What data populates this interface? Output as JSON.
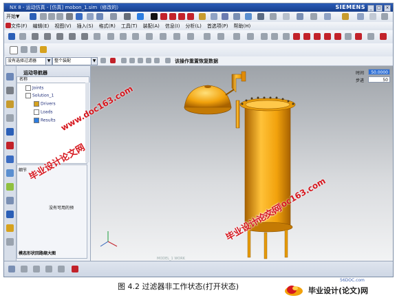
{
  "window": {
    "title": "NX 8 - 运动仿真 - [仿真] mobon_1.sim（修改的）",
    "brand": "SIEMENS",
    "controls": [
      "_",
      "□",
      "×"
    ]
  },
  "toolbar": {
    "start_label": "开始▼"
  },
  "menu": {
    "items": [
      "文件(F)",
      "编辑(E)",
      "视图(V)",
      "插入(S)",
      "格式(R)",
      "工具(T)",
      "装配(A)",
      "信息(I)",
      "分析(L)",
      "首选项(P)",
      "帮助(H)"
    ]
  },
  "selection_bar": {
    "filter": "没有选择过滤器",
    "scope": "整个装配",
    "hint": "该操作重置恢复数据"
  },
  "navigator": {
    "title": "运动导航器",
    "column_header": "名称",
    "nodes": [
      {
        "label": "Joints"
      },
      {
        "label": "Solution_1"
      },
      {
        "label": "Drivers"
      },
      {
        "label": "Loads"
      },
      {
        "label": "Results"
      }
    ],
    "details_header": "细节",
    "empty_text": "没有可用的预",
    "preview_label": "模态形状回路缩大图"
  },
  "animation": {
    "time_label": "时间",
    "time_value": "50.0000",
    "step_label": "步进",
    "step_value": "50"
  },
  "viewport": {
    "model_label": "MODEL_1 WORK"
  },
  "watermarks": {
    "graduate": "毕业设计论文网",
    "doc_site": "www.doc163.com"
  },
  "caption": {
    "text": "图 4.2  过滤器非工作状态(打开状态)"
  },
  "logo": {
    "url": "56DOC.com",
    "name": "毕业设计(论文)网"
  },
  "colors": {
    "model": "#f2a20c",
    "model_dark": "#b86e00",
    "watermark": "#d6181f",
    "title_bar": "#1f4fa6"
  }
}
